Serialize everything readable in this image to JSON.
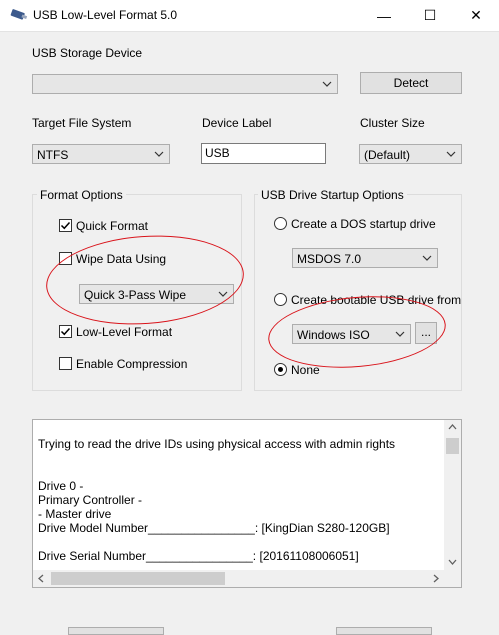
{
  "window": {
    "title": "USB Low-Level Format 5.0",
    "minimize": "—",
    "maximize": "☐",
    "close": "✕"
  },
  "storage": {
    "label": "USB Storage Device",
    "device_value": "",
    "detect_label": "Detect"
  },
  "target_fs": {
    "label": "Target File System",
    "value": "NTFS"
  },
  "device_label": {
    "label": "Device Label",
    "value": "USB"
  },
  "cluster": {
    "label": "Cluster Size",
    "value": "(Default)"
  },
  "format_options": {
    "title": "Format Options",
    "quick_format": {
      "label": "Quick Format",
      "checked": true
    },
    "wipe_data": {
      "label": "Wipe Data Using",
      "checked": false
    },
    "wipe_method": "Quick 3-Pass Wipe",
    "low_level": {
      "label": "Low-Level Format",
      "checked": true
    },
    "compression": {
      "label": "Enable Compression",
      "checked": false
    }
  },
  "startup_options": {
    "title": "USB Drive Startup Options",
    "dos_label": "Create a DOS startup drive",
    "dos_value": "MSDOS 7.0",
    "bootable_label": "Create bootable USB drive from",
    "bootable_value": "Windows ISO",
    "browse_label": "...",
    "none_label": "None",
    "selected": "none"
  },
  "log": {
    "lines": [
      "Trying to read the drive IDs using physical access with admin rights",
      "Drive 0 -",
      "Primary Controller -",
      " - Master drive",
      "Drive Model Number________________: [KingDian S280-120GB]",
      "Drive Serial Number________________: [20161108006051]"
    ]
  },
  "colors": {
    "annotation": "#d9141b",
    "window_bg": "#f0f0f0",
    "button_bg": "#e1e1e1"
  },
  "icons": {
    "app": "usb-drive-icon",
    "combo_arrow": "chevron-down-icon",
    "check": "checkmark-icon"
  }
}
